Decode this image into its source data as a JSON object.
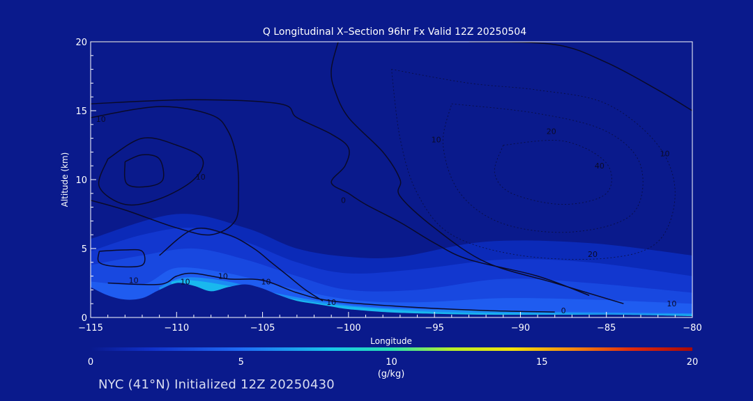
{
  "chart_data": {
    "type": "heatmap",
    "title": "Q Longitudinal X–Section 96hr  Fx Valid 12Z 20250504",
    "xlabel": "Longitude",
    "ylabel": "Altitude (km)",
    "xlim": [
      -115,
      -80
    ],
    "ylim": [
      0,
      20
    ],
    "x_ticks": [
      -115,
      -110,
      -105,
      -100,
      -95,
      -90,
      -85,
      -80
    ],
    "x_tick_labels": [
      "−115",
      "−110",
      "−105",
      "−100",
      "−95",
      "−90",
      "−85",
      "−80"
    ],
    "y_ticks": [
      0,
      5,
      10,
      15,
      20
    ],
    "y_tick_labels": [
      "0",
      "5",
      "10",
      "15",
      "20"
    ],
    "terrain_km": [
      {
        "lon": -115,
        "alt": 2.2
      },
      {
        "lon": -114,
        "alt": 1.6
      },
      {
        "lon": -113,
        "alt": 1.3
      },
      {
        "lon": -112,
        "alt": 1.4
      },
      {
        "lon": -111,
        "alt": 2.0
      },
      {
        "lon": -110,
        "alt": 2.5
      },
      {
        "lon": -109,
        "alt": 2.3
      },
      {
        "lon": -108,
        "alt": 1.9
      },
      {
        "lon": -107,
        "alt": 2.2
      },
      {
        "lon": -106,
        "alt": 2.4
      },
      {
        "lon": -105,
        "alt": 2.1
      },
      {
        "lon": -104,
        "alt": 1.6
      },
      {
        "lon": -103,
        "alt": 1.2
      },
      {
        "lon": -102,
        "alt": 1.0
      },
      {
        "lon": -101,
        "alt": 0.8
      },
      {
        "lon": -100,
        "alt": 0.6
      },
      {
        "lon": -98,
        "alt": 0.4
      },
      {
        "lon": -96,
        "alt": 0.3
      },
      {
        "lon": -92,
        "alt": 0.2
      },
      {
        "lon": -88,
        "alt": 0.2
      },
      {
        "lon": -84,
        "alt": 0.2
      },
      {
        "lon": -80,
        "alt": 0.1
      }
    ],
    "q_field_bands": [
      {
        "q_gkg": 1,
        "color": "#0b2ab8",
        "top": [
          {
            "lon": -115,
            "alt": 5.7
          },
          {
            "lon": -110,
            "alt": 7.5
          },
          {
            "lon": -106,
            "alt": 6.5
          },
          {
            "lon": -103,
            "alt": 5.0
          },
          {
            "lon": -100,
            "alt": 4.4
          },
          {
            "lon": -97,
            "alt": 4.4
          },
          {
            "lon": -92,
            "alt": 5.5
          },
          {
            "lon": -86,
            "alt": 5.4
          },
          {
            "lon": -80,
            "alt": 4.5
          }
        ]
      },
      {
        "q_gkg": 2,
        "color": "#1237cf",
        "top": [
          {
            "lon": -115,
            "alt": 4.8
          },
          {
            "lon": -112,
            "alt": 6.0
          },
          {
            "lon": -109,
            "alt": 6.5
          },
          {
            "lon": -106,
            "alt": 5.5
          },
          {
            "lon": -103,
            "alt": 4.0
          },
          {
            "lon": -100,
            "alt": 3.2
          },
          {
            "lon": -96,
            "alt": 3.5
          },
          {
            "lon": -91,
            "alt": 4.2
          },
          {
            "lon": -86,
            "alt": 4.0
          },
          {
            "lon": -80,
            "alt": 3.0
          }
        ]
      },
      {
        "q_gkg": 3,
        "color": "#1848e0",
        "top": [
          {
            "lon": -115,
            "alt": 3.8
          },
          {
            "lon": -112,
            "alt": 4.5
          },
          {
            "lon": -109,
            "alt": 5.0
          },
          {
            "lon": -106,
            "alt": 4.2
          },
          {
            "lon": -103,
            "alt": 3.0
          },
          {
            "lon": -100,
            "alt": 2.0
          },
          {
            "lon": -96,
            "alt": 2.0
          },
          {
            "lon": -91,
            "alt": 2.8
          },
          {
            "lon": -86,
            "alt": 2.5
          },
          {
            "lon": -80,
            "alt": 1.8
          }
        ]
      },
      {
        "q_gkg": 4,
        "color": "#1f5cf0",
        "top": [
          {
            "lon": -115,
            "alt": 2.6
          },
          {
            "lon": -112,
            "alt": 2.4
          },
          {
            "lon": -110,
            "alt": 3.6
          },
          {
            "lon": -107,
            "alt": 3.2
          },
          {
            "lon": -104,
            "alt": 2.3
          },
          {
            "lon": -100,
            "alt": 1.3
          },
          {
            "lon": -96,
            "alt": 1.1
          },
          {
            "lon": -91,
            "alt": 1.4
          },
          {
            "lon": -86,
            "alt": 1.3
          },
          {
            "lon": -80,
            "alt": 1.0
          }
        ]
      },
      {
        "q_gkg": 6,
        "color": "#1b8cf4",
        "top": [
          {
            "lon": -111,
            "alt": 2.2
          },
          {
            "lon": -109.5,
            "alt": 2.9
          },
          {
            "lon": -107,
            "alt": 2.6
          },
          {
            "lon": -104,
            "alt": 1.7
          },
          {
            "lon": -100,
            "alt": 0.9
          },
          {
            "lon": -96,
            "alt": 0.6
          },
          {
            "lon": -92,
            "alt": 0.5
          },
          {
            "lon": -88,
            "alt": 0.4
          },
          {
            "lon": -80,
            "alt": 0.3
          }
        ]
      },
      {
        "q_gkg": 8,
        "color": "#19b8ee",
        "top": [
          {
            "lon": -110.3,
            "alt": 2.6
          },
          {
            "lon": -109.2,
            "alt": 2.7
          },
          {
            "lon": -107,
            "alt": 2.3
          },
          {
            "lon": -103,
            "alt": 1.3
          },
          {
            "lon": -100,
            "alt": 0.8
          },
          {
            "lon": -95,
            "alt": 0.4
          },
          {
            "lon": -90,
            "alt": 0.3
          },
          {
            "lon": -80,
            "alt": 0.2
          }
        ]
      }
    ],
    "contours": [
      {
        "value": 0,
        "style": "solid",
        "points": [
          {
            "lon": -115,
            "alt": 20
          },
          {
            "lon": -104,
            "alt": 20
          }
        ]
      },
      {
        "value": 0,
        "style": "solid",
        "points": [
          {
            "lon": -115,
            "alt": 15.5
          },
          {
            "lon": -109,
            "alt": 15.8
          },
          {
            "lon": -104,
            "alt": 15.5
          },
          {
            "lon": -103,
            "alt": 14.5
          },
          {
            "lon": -101,
            "alt": 13.3
          },
          {
            "lon": -100,
            "alt": 12.3
          },
          {
            "lon": -100.2,
            "alt": 11.0
          },
          {
            "lon": -101,
            "alt": 9.8
          },
          {
            "lon": -100,
            "alt": 9.0
          },
          {
            "lon": -99,
            "alt": 8.2
          },
          {
            "lon": -97,
            "alt": 6.9
          },
          {
            "lon": -95,
            "alt": 5.4
          },
          {
            "lon": -93,
            "alt": 4.2
          },
          {
            "lon": -89,
            "alt": 3.0
          },
          {
            "lon": -86,
            "alt": 1.6
          }
        ]
      },
      {
        "value": 0,
        "style": "solid",
        "points": [
          {
            "lon": -100.6,
            "alt": 20
          },
          {
            "lon": -101,
            "alt": 18.0
          },
          {
            "lon": -100.8,
            "alt": 16.5
          },
          {
            "lon": -100,
            "alt": 14.5
          },
          {
            "lon": -98,
            "alt": 12.0
          },
          {
            "lon": -97,
            "alt": 10.0
          },
          {
            "lon": -97,
            "alt": 8.8
          },
          {
            "lon": -95,
            "alt": 6.5
          },
          {
            "lon": -92,
            "alt": 4.0
          },
          {
            "lon": -88,
            "alt": 2.5
          },
          {
            "lon": -84,
            "alt": 1.0
          }
        ]
      },
      {
        "value": -10,
        "style": "solid",
        "points": [
          {
            "lon": -115,
            "alt": 14.5
          },
          {
            "lon": -111,
            "alt": 15.3
          },
          {
            "lon": -108,
            "alt": 14.7
          },
          {
            "lon": -107,
            "alt": 13.5
          },
          {
            "lon": -106.5,
            "alt": 11.5
          },
          {
            "lon": -106.4,
            "alt": 9.0
          },
          {
            "lon": -106.6,
            "alt": 7.0
          },
          {
            "lon": -108,
            "alt": 6.0
          },
          {
            "lon": -110,
            "alt": 6.5
          },
          {
            "lon": -113,
            "alt": 7.8
          },
          {
            "lon": -115,
            "alt": 8.5
          }
        ]
      },
      {
        "value": -20,
        "style": "solid",
        "points": [
          {
            "lon": -114,
            "alt": 11.5
          },
          {
            "lon": -112,
            "alt": 13.0
          },
          {
            "lon": -110,
            "alt": 12.5
          },
          {
            "lon": -108.5,
            "alt": 11.5
          },
          {
            "lon": -109,
            "alt": 10.0
          },
          {
            "lon": -111,
            "alt": 8.6
          },
          {
            "lon": -113,
            "alt": 8.2
          },
          {
            "lon": -114.5,
            "alt": 9.5
          },
          {
            "lon": -114,
            "alt": 11.5
          }
        ]
      },
      {
        "value": -30,
        "style": "solid",
        "points": [
          {
            "lon": -113,
            "alt": 11.3
          },
          {
            "lon": -112,
            "alt": 11.8
          },
          {
            "lon": -111,
            "alt": 11.5
          },
          {
            "lon": -110.8,
            "alt": 10.0
          },
          {
            "lon": -111.7,
            "alt": 9.5
          },
          {
            "lon": -112.9,
            "alt": 9.7
          },
          {
            "lon": -113,
            "alt": 11.3
          }
        ]
      },
      {
        "value": 0,
        "style": "solid",
        "points": [
          {
            "lon": -93,
            "alt": 20
          },
          {
            "lon": -88,
            "alt": 19.8
          },
          {
            "lon": -85,
            "alt": 18.5
          },
          {
            "lon": -82,
            "alt": 16.5
          },
          {
            "lon": -80,
            "alt": 15.0
          }
        ]
      },
      {
        "value": 10,
        "style": "solid",
        "points": [
          {
            "lon": -114,
            "alt": 2.5
          },
          {
            "lon": -111,
            "alt": 2.4
          },
          {
            "lon": -110,
            "alt": 3.0
          },
          {
            "lon": -109,
            "alt": 3.2
          },
          {
            "lon": -107,
            "alt": 2.8
          },
          {
            "lon": -105,
            "alt": 2.7
          },
          {
            "lon": -103,
            "alt": 1.8
          },
          {
            "lon": -101,
            "alt": 1.2
          },
          {
            "lon": -97,
            "alt": 0.8
          },
          {
            "lon": -92,
            "alt": 0.5
          },
          {
            "lon": -88,
            "alt": 0.4
          }
        ]
      },
      {
        "value": -10,
        "style": "solid",
        "points": [
          {
            "lon": -114.5,
            "alt": 4.8
          },
          {
            "lon": -113,
            "alt": 4.9
          },
          {
            "lon": -112,
            "alt": 4.8
          },
          {
            "lon": -112,
            "alt": 3.8
          },
          {
            "lon": -113.5,
            "alt": 3.7
          },
          {
            "lon": -114.5,
            "alt": 4.0
          },
          {
            "lon": -114.5,
            "alt": 4.8
          }
        ]
      },
      {
        "value": -10,
        "style": "solid",
        "points": [
          {
            "lon": -111,
            "alt": 4.5
          },
          {
            "lon": -109,
            "alt": 6.4
          },
          {
            "lon": -107,
            "alt": 6.0
          },
          {
            "lon": -105.5,
            "alt": 5.0
          },
          {
            "lon": -104.5,
            "alt": 4.0
          },
          {
            "lon": -103.5,
            "alt": 3.0
          },
          {
            "lon": -102.5,
            "alt": 2.0
          },
          {
            "lon": -101.5,
            "alt": 1.2
          }
        ]
      },
      {
        "value": -20,
        "style": "dashed",
        "points": [
          {
            "lon": -97.5,
            "alt": 18.0
          },
          {
            "lon": -93,
            "alt": 17.0
          },
          {
            "lon": -89,
            "alt": 16.5
          },
          {
            "lon": -85,
            "alt": 15.5
          },
          {
            "lon": -82,
            "alt": 12.5
          },
          {
            "lon": -81,
            "alt": 9.0
          },
          {
            "lon": -82,
            "alt": 5.5
          },
          {
            "lon": -85,
            "alt": 4.3
          },
          {
            "lon": -90,
            "alt": 4.5
          },
          {
            "lon": -94,
            "alt": 6.0
          },
          {
            "lon": -96,
            "alt": 9.0
          },
          {
            "lon": -97,
            "alt": 13.0
          },
          {
            "lon": -97.5,
            "alt": 18.0
          }
        ]
      },
      {
        "value": -30,
        "style": "dashed",
        "points": [
          {
            "lon": -94,
            "alt": 15.5
          },
          {
            "lon": -89,
            "alt": 14.8
          },
          {
            "lon": -85,
            "alt": 13.5
          },
          {
            "lon": -83,
            "alt": 11.0
          },
          {
            "lon": -83.5,
            "alt": 7.5
          },
          {
            "lon": -87,
            "alt": 6.2
          },
          {
            "lon": -91,
            "alt": 6.8
          },
          {
            "lon": -93.5,
            "alt": 9.0
          },
          {
            "lon": -94.5,
            "alt": 12.5
          },
          {
            "lon": -94,
            "alt": 15.5
          }
        ]
      },
      {
        "value": -40,
        "style": "dashed",
        "points": [
          {
            "lon": -91,
            "alt": 12.5
          },
          {
            "lon": -87.5,
            "alt": 12.8
          },
          {
            "lon": -85,
            "alt": 11.2
          },
          {
            "lon": -85,
            "alt": 9.0
          },
          {
            "lon": -87.5,
            "alt": 8.2
          },
          {
            "lon": -90.5,
            "alt": 9.0
          },
          {
            "lon": -91.5,
            "alt": 10.5
          },
          {
            "lon": -91,
            "alt": 12.5
          }
        ]
      }
    ],
    "contour_labels": [
      {
        "text": "10",
        "lon": -112.5,
        "alt": 2.5
      },
      {
        "text": "10",
        "lon": -109.5,
        "alt": 2.4
      },
      {
        "text": "10",
        "lon": -107.3,
        "alt": 2.8
      },
      {
        "text": "10",
        "lon": -104.8,
        "alt": 2.4
      },
      {
        "text": "10",
        "lon": -101,
        "alt": 0.9
      },
      {
        "text": "10",
        "lon": -81.2,
        "alt": 0.8
      },
      {
        "text": "0",
        "lon": -100.3,
        "alt": 8.3
      },
      {
        "text": "0",
        "lon": -87.5,
        "alt": 0.3
      },
      {
        "text": "10",
        "lon": -108.6,
        "alt": 10.0
      },
      {
        "text": "10",
        "lon": -114.4,
        "alt": 14.2
      },
      {
        "text": "20",
        "lon": -88.2,
        "alt": 13.3
      },
      {
        "text": "10",
        "lon": -94.9,
        "alt": 12.7
      },
      {
        "text": "10",
        "lon": -81.6,
        "alt": 11.7
      },
      {
        "text": "40",
        "lon": -85.4,
        "alt": 10.8
      },
      {
        "text": "20",
        "lon": -85.8,
        "alt": 4.4
      }
    ],
    "colorbar": {
      "label": "(g/kg)",
      "min": 0,
      "max": 20,
      "ticks": [
        0,
        5,
        10,
        15,
        20
      ],
      "tick_labels": [
        "0",
        "5",
        "10",
        "15",
        "20"
      ],
      "stops": [
        {
          "value": 0,
          "color": "#0a1a8c"
        },
        {
          "value": 2,
          "color": "#1030c8"
        },
        {
          "value": 5,
          "color": "#1f6cf5"
        },
        {
          "value": 8,
          "color": "#18c6ea"
        },
        {
          "value": 10,
          "color": "#28e0b0"
        },
        {
          "value": 12,
          "color": "#b6ee2a"
        },
        {
          "value": 14,
          "color": "#f2e20a"
        },
        {
          "value": 16,
          "color": "#f48a10"
        },
        {
          "value": 18,
          "color": "#e02a0c"
        },
        {
          "value": 20,
          "color": "#a80a08"
        }
      ],
      "center_tick_label": "10"
    },
    "background_color": "#0a1a8c"
  },
  "footer": {
    "caption": "NYC (41°N) Initialized 12Z 20250430"
  }
}
